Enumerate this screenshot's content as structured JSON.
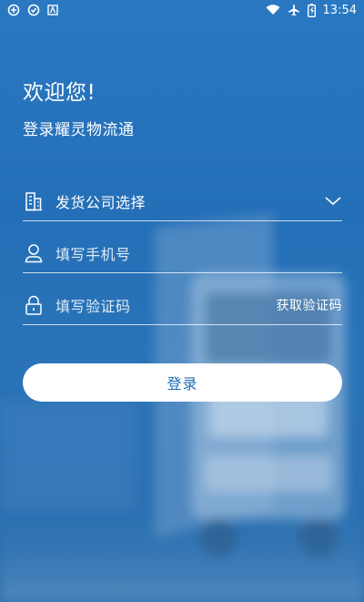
{
  "status_bar": {
    "time": "13:54",
    "icons": [
      "app-icon-1",
      "app-icon-2",
      "app-icon-3",
      "wifi-icon",
      "airplane-icon",
      "battery-icon"
    ]
  },
  "header": {
    "welcome": "欢迎您!",
    "subtitle": "登录耀灵物流通"
  },
  "form": {
    "company": {
      "label": "发货公司选择",
      "icon": "building-icon"
    },
    "phone": {
      "placeholder": "填写手机号",
      "icon": "user-icon"
    },
    "code": {
      "placeholder": "填写验证码",
      "icon": "lock-icon",
      "get_code_label": "获取验证码"
    },
    "login_label": "登录"
  },
  "colors": {
    "background": "#2a78c2",
    "button_text": "#1f6cb3",
    "button_bg": "#ffffff"
  }
}
